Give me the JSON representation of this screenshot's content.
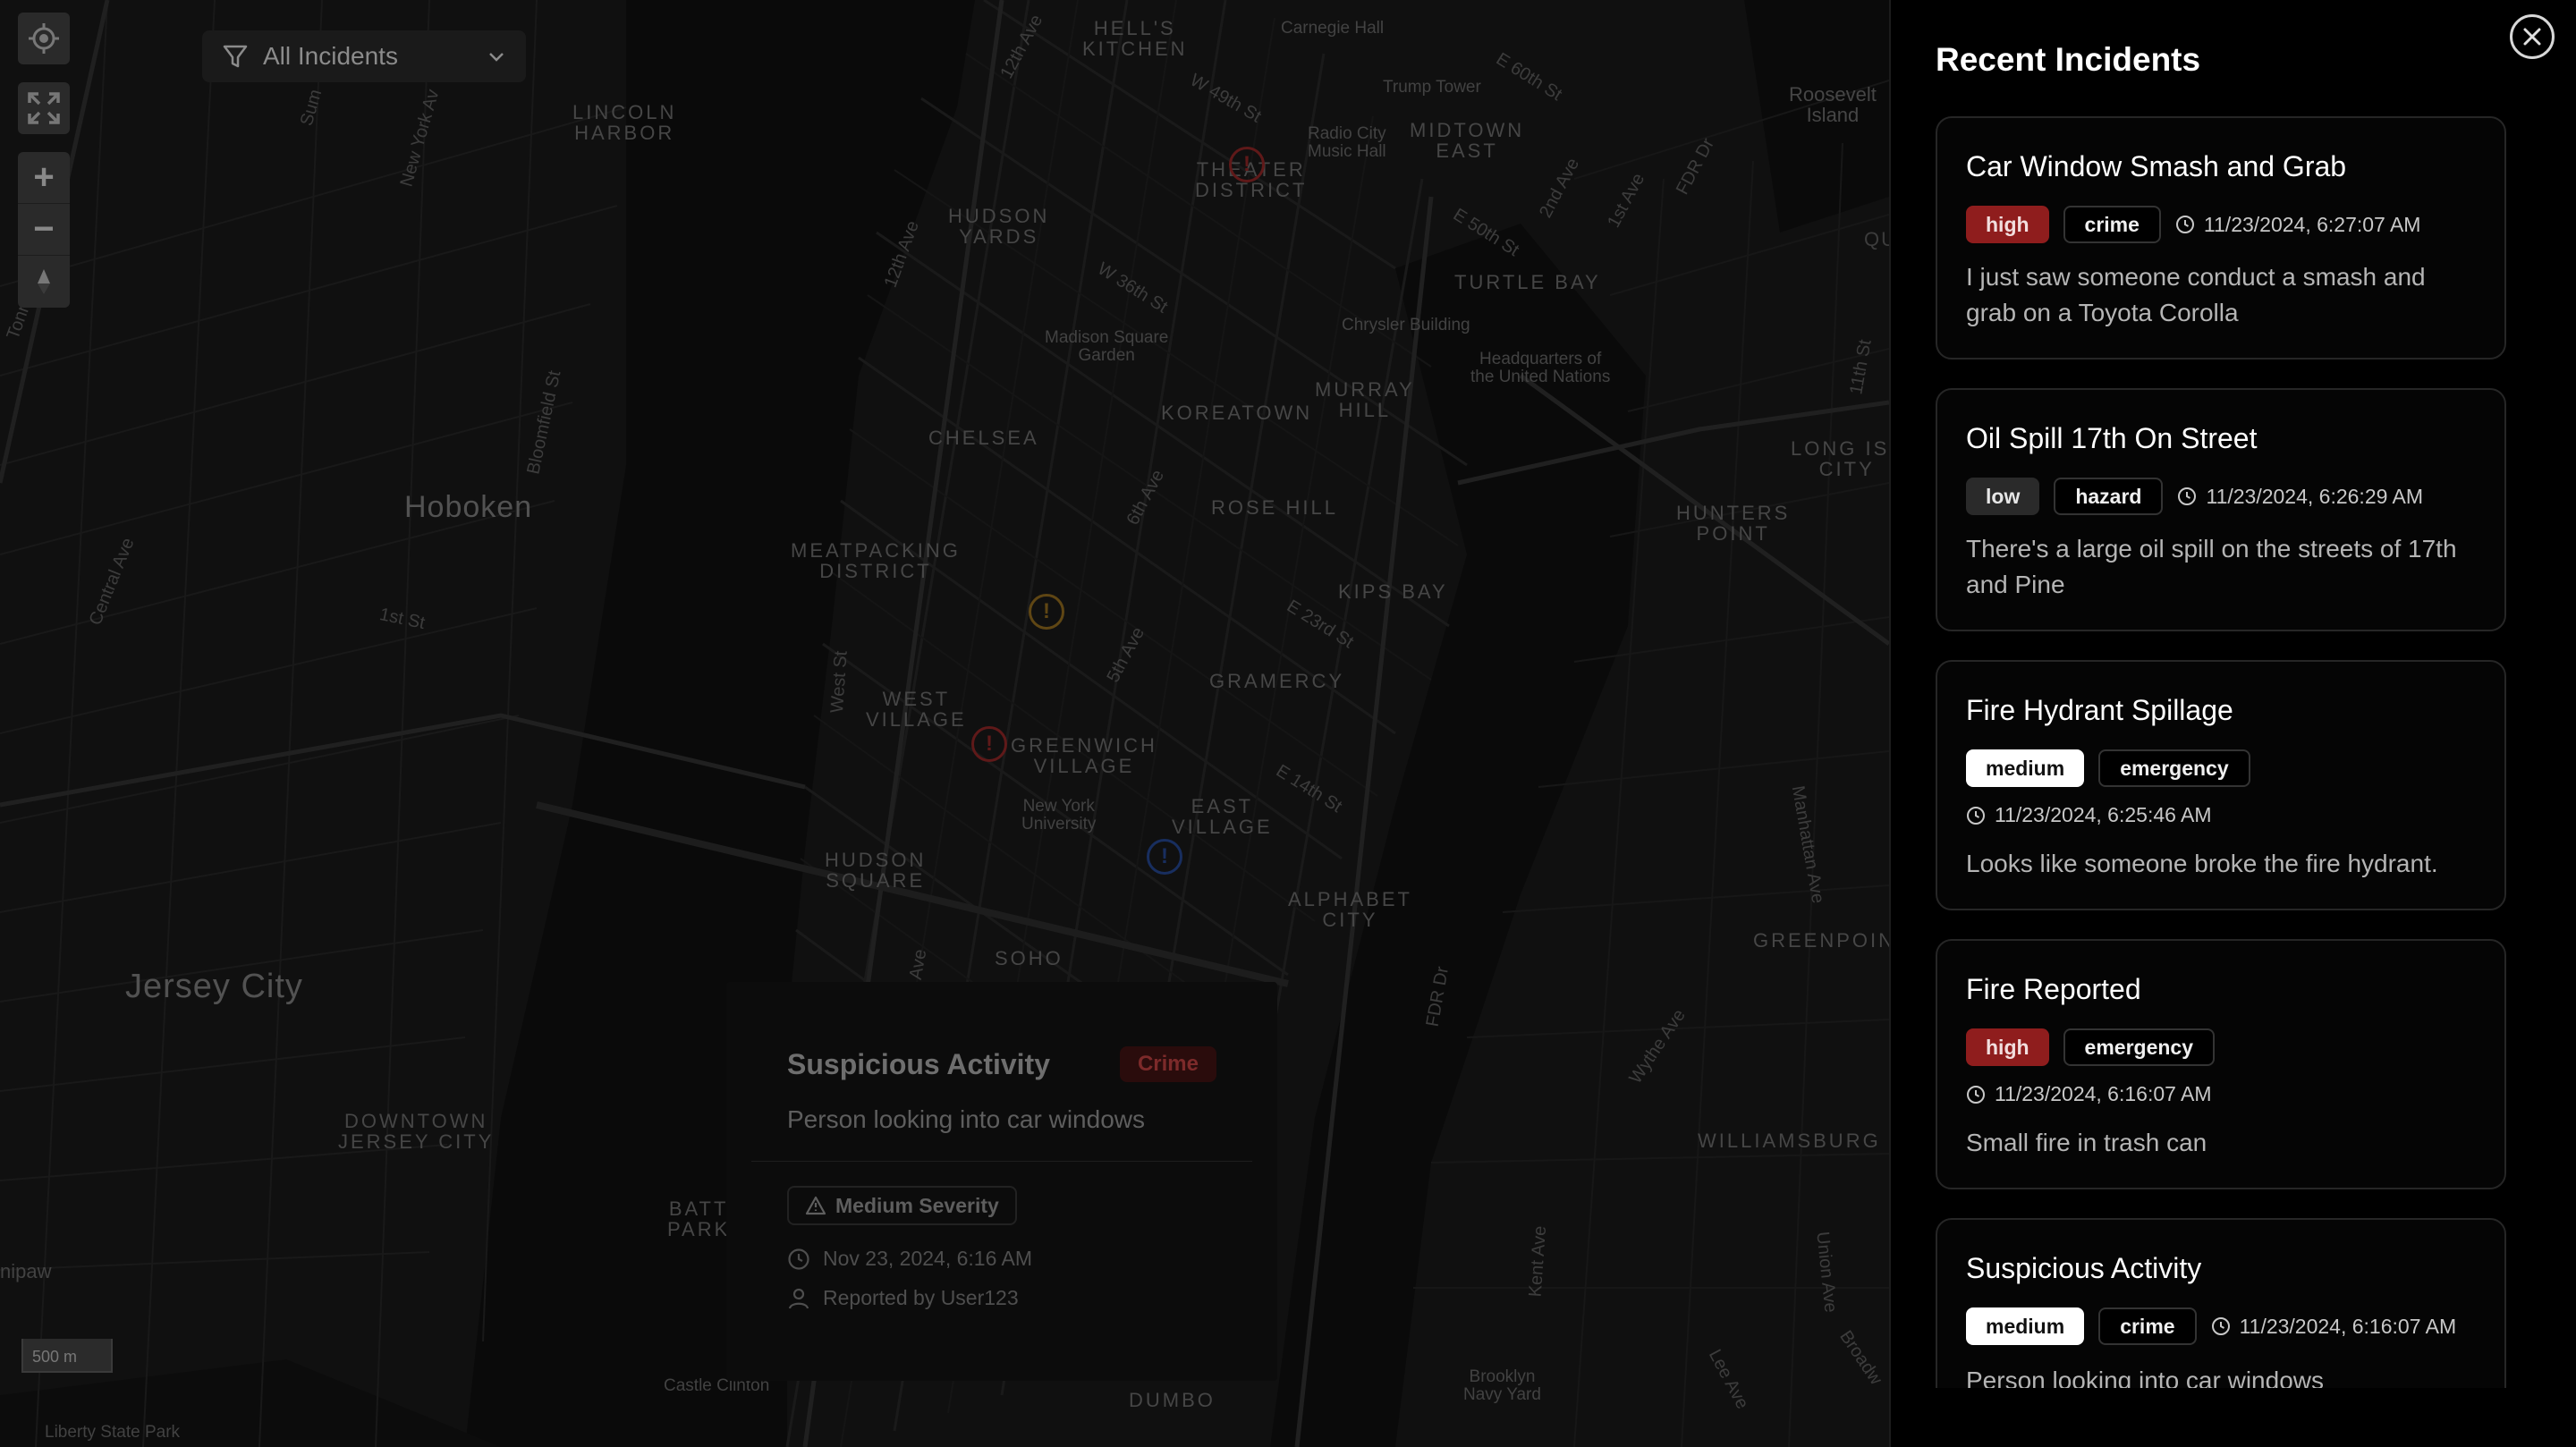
{
  "map": {
    "filter": {
      "label": "All Incidents",
      "icon": "filter-icon",
      "chevron": "chevron-down-icon"
    },
    "controls": {
      "locate_icon": "crosshair-icon",
      "fullscreen_icon": "fullscreen-icon",
      "zoom_in": "+",
      "zoom_out": "−",
      "compass_icon": "compass-icon"
    },
    "scale": "500 m",
    "labels": {
      "hells_kitchen": "HELL'S\nKITCHEN",
      "lincoln_harbor": "LINCOLN\nHARBOR",
      "theater_district": "THEATER\nDISTRICT",
      "midtown_east": "MIDTOWN\nEAST",
      "hudson_yards": "HUDSON\nYARDS",
      "turtle_bay": "TURTLE BAY",
      "chelsea": "CHELSEA",
      "koreatown": "KOREATOWN",
      "murray_hill": "MURRAY\nHILL",
      "meatpacking": "MEATPACKING\nDISTRICT",
      "rose_hill": "ROSE HILL",
      "kips_bay": "KIPS BAY",
      "gramercy": "GRAMERCY",
      "west_village": "WEST\nVILLAGE",
      "greenwich_village": "GREENWICH\nVILLAGE",
      "east_village": "EAST\nVILLAGE",
      "hudson_square": "HUDSON\nSQUARE",
      "alphabet_city": "ALPHABET\nCITY",
      "soho": "SOHO",
      "downtown_jc": "DOWNTOWN\nJERSEY CITY",
      "battery_park": "BATT\nPARK",
      "dumbo": "DUMBO",
      "hunters_point": "HUNTERS\nPOINT",
      "long_island_city": "LONG ISL\nCITY",
      "greenpoint": "GREENPOIN",
      "williamsburg": "WILLIAMSBURG",
      "hoboken": "Hoboken",
      "jersey_city": "Jersey City",
      "carnegie_hall": "Carnegie Hall",
      "trump_tower": "Trump Tower",
      "radio_city": "Radio City\nMusic Hall",
      "roosevelt_island": "Roosevelt\nIsland",
      "madison_square": "Madison Square\nGarden",
      "chrysler": "Chrysler Building",
      "un_hq": "Headquarters of\nthe United Nations",
      "nyu": "New York\nUniversity",
      "brooklyn_navy": "Brooklyn\nNavy Yard",
      "liberty_park": "Liberty State Park",
      "castle_clinton": "Castle Clinton",
      "paulus": "nipaw",
      "st_w49": "W 49th St",
      "st_e60": "E 60th St",
      "st_e50": "E 50th St",
      "st_w36": "W 36th St",
      "st_e23": "E 23rd St",
      "st_e14": "E 14th St",
      "st_1st": "1st St",
      "st_12th_ave": "12th Ave",
      "st_2nd_ave": "2nd Ave",
      "st_1st_ave": "1st Ave",
      "st_fdr": "FDR Dr",
      "st_fdr2": "FDR Dr",
      "st_6th_ave": "6th Ave",
      "st_5th_ave": "5th Ave",
      "st_west_st": "West St",
      "st_12th_ave2": "12th Ave",
      "st_bloomfield": "Bloomfield St",
      "st_central": "Central Ave",
      "st_newyork": "New York Av",
      "st_sum": "Sum",
      "st_11th": "11th St",
      "st_manhattan": "Manhattan Ave",
      "st_wythe": "Wythe Ave",
      "st_kent": "Kent Ave",
      "st_union": "Union Ave",
      "st_lee": "Lee Ave",
      "st_broadway": "Broadw",
      "st_tonn": "Tonn",
      "st_ave": "Ave",
      "st_qu": "QU"
    },
    "markers": [
      {
        "name": "marker-theater",
        "color": "#7a2020"
      },
      {
        "name": "marker-chelsea",
        "color": "#7a5a1a"
      },
      {
        "name": "marker-greenwich",
        "color": "#7a2020"
      },
      {
        "name": "marker-east-village",
        "color": "#1f3c7a"
      }
    ],
    "popup": {
      "title": "Suspicious Activity",
      "category": "Crime",
      "description": "Person looking into car windows",
      "severity": "Medium Severity",
      "datetime": "Nov 23, 2024, 6:16 AM",
      "reporter": "Reported by User123"
    }
  },
  "sidebar": {
    "title": "Recent Incidents",
    "close_icon": "close-icon",
    "incidents": [
      {
        "title": "Car Window Smash and Grab",
        "severity": "high",
        "category": "crime",
        "time": "11/23/2024, 6:27:07 AM",
        "description": "I just saw someone conduct a smash and grab on a Toyota Corolla"
      },
      {
        "title": "Oil Spill 17th On Street",
        "severity": "low",
        "category": "hazard",
        "time": "11/23/2024, 6:26:29 AM",
        "description": "There's a large oil spill on the streets of 17th and Pine"
      },
      {
        "title": "Fire Hydrant Spillage",
        "severity": "medium",
        "category": "emergency",
        "time": "11/23/2024, 6:25:46 AM",
        "description": "Looks like someone broke the fire hydrant."
      },
      {
        "title": "Fire Reported",
        "severity": "high",
        "category": "emergency",
        "time": "11/23/2024, 6:16:07 AM",
        "description": "Small fire in trash can"
      },
      {
        "title": "Suspicious Activity",
        "severity": "medium",
        "category": "crime",
        "time": "11/23/2024, 6:16:07 AM",
        "description": "Person looking into car windows"
      }
    ]
  }
}
